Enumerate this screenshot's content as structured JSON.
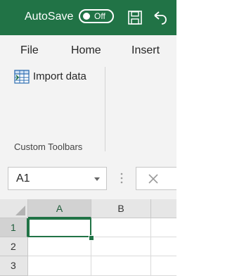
{
  "titlebar": {
    "autosave_label": "AutoSave",
    "autosave_state": "Off",
    "bg_color": "#217346",
    "icons": [
      "save-icon",
      "undo-icon"
    ]
  },
  "ribbon": {
    "tabs": [
      {
        "label": "File"
      },
      {
        "label": "Home"
      },
      {
        "label": "Insert"
      }
    ],
    "import_button_label": "Import data",
    "import_icon": "table-import-icon",
    "group_label": "Custom Toolbars"
  },
  "formula_bar": {
    "name_box_value": "A1",
    "icons": [
      "chevron-down-icon",
      "more-dots-icon",
      "cancel-icon"
    ]
  },
  "grid": {
    "columns": [
      "A",
      "B"
    ],
    "rows": [
      "1",
      "2",
      "3"
    ],
    "active_cell": "A1",
    "accent_color": "#217346"
  }
}
